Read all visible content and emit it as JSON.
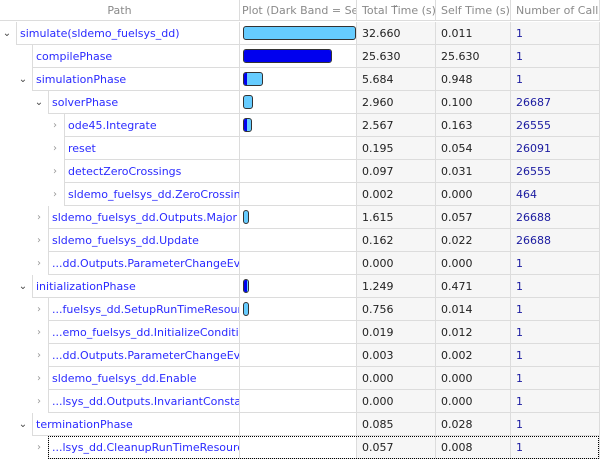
{
  "headers": {
    "path": "Path",
    "plot": "Plot (Dark Band = Self",
    "total": "Total Time (s)",
    "self": "Self Time (s)",
    "calls": "Number of Calls"
  },
  "colors": {
    "bar": "#66ccff",
    "self_band": "#0000ee",
    "link": "#2b2bff"
  },
  "max_total": 32.66,
  "rows": [
    {
      "name": "simulate(sldemo_fuelsys_dd)",
      "level": 0,
      "toggle": "expanded",
      "total": "32.660",
      "self": "0.011",
      "calls": "1"
    },
    {
      "name": "compilePhase",
      "level": 1,
      "toggle": "none",
      "total": "25.630",
      "self": "25.630",
      "calls": "1"
    },
    {
      "name": "simulationPhase",
      "level": 1,
      "toggle": "expanded",
      "total": "5.684",
      "self": "0.948",
      "calls": "1"
    },
    {
      "name": "solverPhase",
      "level": 2,
      "toggle": "expanded",
      "total": "2.960",
      "self": "0.100",
      "calls": "26687"
    },
    {
      "name": "ode45.Integrate",
      "level": 3,
      "toggle": "collapsed",
      "total": "2.567",
      "self": "0.163",
      "calls": "26555"
    },
    {
      "name": "reset",
      "level": 3,
      "toggle": "collapsed",
      "total": "0.195",
      "self": "0.054",
      "calls": "26091"
    },
    {
      "name": "detectZeroCrossings",
      "level": 3,
      "toggle": "collapsed",
      "total": "0.097",
      "self": "0.031",
      "calls": "26555"
    },
    {
      "name": "sldemo_fuelsys_dd.ZeroCrossings",
      "level": 3,
      "toggle": "collapsed",
      "total": "0.002",
      "self": "0.000",
      "calls": "464"
    },
    {
      "name": "sldemo_fuelsys_dd.Outputs.Major",
      "level": 2,
      "toggle": "collapsed",
      "total": "1.615",
      "self": "0.057",
      "calls": "26688"
    },
    {
      "name": "sldemo_fuelsys_dd.Update",
      "level": 2,
      "toggle": "collapsed",
      "total": "0.162",
      "self": "0.022",
      "calls": "26688"
    },
    {
      "name": "...dd.Outputs.ParameterChangeEvent",
      "level": 2,
      "toggle": "collapsed",
      "total": "0.000",
      "self": "0.000",
      "calls": "1"
    },
    {
      "name": "initializationPhase",
      "level": 1,
      "toggle": "expanded",
      "total": "1.249",
      "self": "0.471",
      "calls": "1"
    },
    {
      "name": "...fuelsys_dd.SetupRunTimeResources",
      "level": 2,
      "toggle": "collapsed",
      "total": "0.756",
      "self": "0.014",
      "calls": "1"
    },
    {
      "name": "...emo_fuelsys_dd.InitializeConditions",
      "level": 2,
      "toggle": "collapsed",
      "total": "0.019",
      "self": "0.012",
      "calls": "1"
    },
    {
      "name": "...dd.Outputs.ParameterChangeEvent",
      "level": 2,
      "toggle": "collapsed",
      "total": "0.003",
      "self": "0.002",
      "calls": "1"
    },
    {
      "name": "sldemo_fuelsys_dd.Enable",
      "level": 2,
      "toggle": "collapsed",
      "total": "0.000",
      "self": "0.000",
      "calls": "1"
    },
    {
      "name": "...lsys_dd.Outputs.InvariantConstants",
      "level": 2,
      "toggle": "collapsed",
      "total": "0.000",
      "self": "0.000",
      "calls": "1"
    },
    {
      "name": "terminationPhase",
      "level": 1,
      "toggle": "expanded",
      "total": "0.085",
      "self": "0.028",
      "calls": "1"
    },
    {
      "name": "...lsys_dd.CleanupRunTimeResources",
      "level": 2,
      "toggle": "collapsed",
      "total": "0.057",
      "self": "0.008",
      "calls": "1"
    }
  ]
}
